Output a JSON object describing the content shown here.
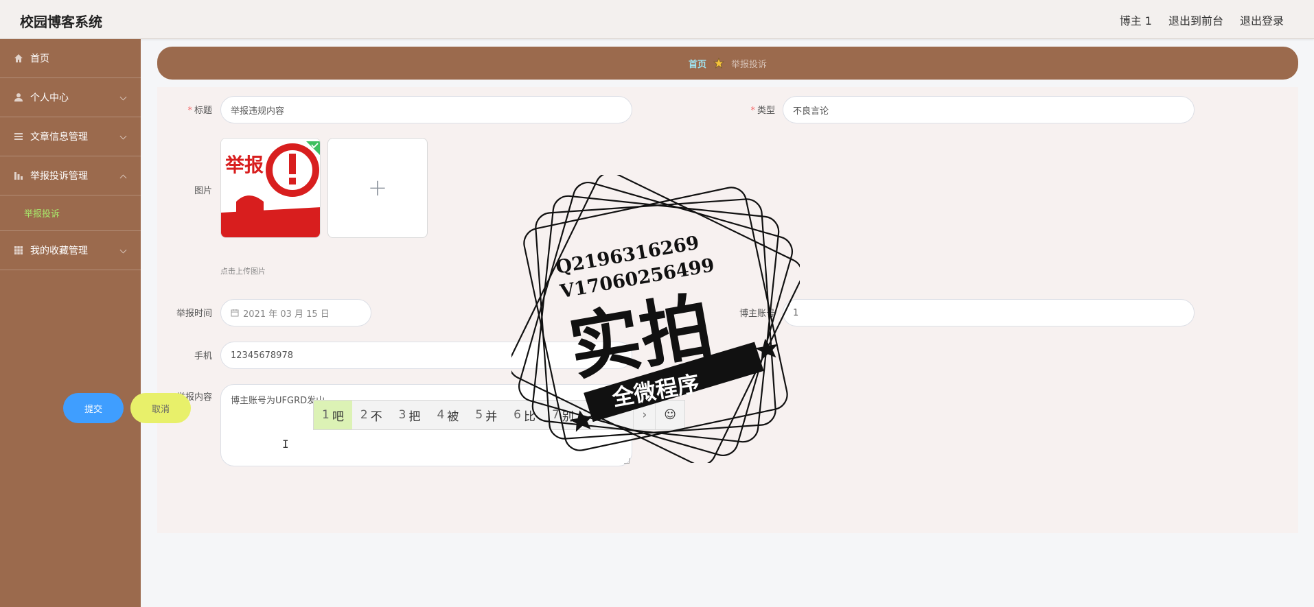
{
  "header": {
    "brand": "校园博客系统",
    "user": "博主 1",
    "exit_front": "退出到前台",
    "logout": "退出登录"
  },
  "sidebar": {
    "items": [
      {
        "label": "首页",
        "icon": "home-icon"
      },
      {
        "label": "个人中心",
        "icon": "user-icon"
      },
      {
        "label": "文章信息管理",
        "icon": "list-icon"
      },
      {
        "label": "举报投诉管理",
        "icon": "chart-icon",
        "sub": [
          "举报投诉"
        ]
      },
      {
        "label": "我的收藏管理",
        "icon": "grid-icon"
      }
    ]
  },
  "breadcrumb": {
    "home": "首页",
    "current": "举报投诉"
  },
  "form": {
    "title_label": "标题",
    "title_value": "举报违规内容",
    "type_label": "类型",
    "type_value": "不良言论",
    "image_label": "图片",
    "upload_hint": "点击上传图片",
    "time_label": "举报时间",
    "time_value": "2021 年 03 月 15 日",
    "account_label": "博主账号",
    "account_value": "1",
    "phone_label": "手机",
    "phone_value": "12345678978",
    "content_label": "举报内容",
    "content_value": "博主账号为UFGRD发山",
    "submit": "提交",
    "cancel": "取消"
  },
  "ime": {
    "candidates": [
      {
        "n": "1",
        "c": "吧"
      },
      {
        "n": "2",
        "c": "不"
      },
      {
        "n": "3",
        "c": "把"
      },
      {
        "n": "4",
        "c": "被"
      },
      {
        "n": "5",
        "c": "并"
      },
      {
        "n": "6",
        "c": "比"
      },
      {
        "n": "7",
        "c": "别"
      }
    ],
    "next": "›",
    "emoji": "☺"
  },
  "thumb_text": "举报",
  "watermark": {
    "line1": "Q2196316269",
    "line2": "V17060256499",
    "main": "实拍",
    "ribbon": "全微程序"
  },
  "colors": {
    "sidebar": "#9b6a4d",
    "submit": "#3f9eff",
    "cancel": "#e8f06a",
    "active_sub": "#a8e86b"
  }
}
